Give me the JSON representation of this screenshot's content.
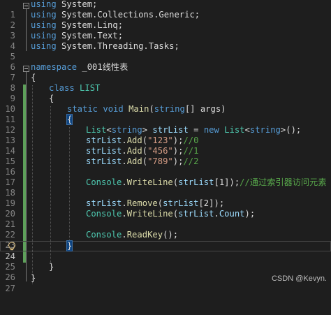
{
  "editor": {
    "current_line": "24",
    "lines": [
      {
        "n": "1"
      },
      {
        "n": "2"
      },
      {
        "n": "3"
      },
      {
        "n": "4"
      },
      {
        "n": "5"
      },
      {
        "n": "6"
      },
      {
        "n": "7"
      },
      {
        "n": "8"
      },
      {
        "n": "9"
      },
      {
        "n": "10"
      },
      {
        "n": "11"
      },
      {
        "n": "12"
      },
      {
        "n": "13"
      },
      {
        "n": "14"
      },
      {
        "n": "15"
      },
      {
        "n": "16"
      },
      {
        "n": "17"
      },
      {
        "n": "18"
      },
      {
        "n": "19"
      },
      {
        "n": "20"
      },
      {
        "n": "21"
      },
      {
        "n": "22"
      },
      {
        "n": "23"
      },
      {
        "n": "24"
      },
      {
        "n": "25"
      },
      {
        "n": "26"
      },
      {
        "n": "27"
      }
    ],
    "tokens": {
      "using": "using",
      "sys": " System;",
      "sys_collections": " System.Collections.Generic;",
      "sys_linq": " System.Linq;",
      "sys_text": " System.Text;",
      "sys_tasks": " System.Threading.Tasks;",
      "namespace_kw": "namespace",
      "namespace_name": " _001线性表",
      "open_brace": "{",
      "close_brace": "}",
      "class_kw": "class",
      "class_name": " LIST",
      "static_kw": "static",
      "void_kw": "void",
      "main": "Main",
      "main_params_open": "(",
      "string_kw": "string",
      "args": "[] args)",
      "list_type": "List",
      "lt": "<",
      "gt_space": "> ",
      "strList": "strList",
      "eq": " = ",
      "new_kw": "new",
      "space": " ",
      "list_ctor_end": ">();",
      "dot_add": ".",
      "add": "Add",
      "paren_open": "(",
      "str_123": "\"123\"",
      "str_456": "\"456\"",
      "str_789": "\"789\"",
      "paren_close_semi": ");",
      "cmt_0": "//0",
      "cmt_1": "//1",
      "cmt_2": "//2",
      "console": "Console",
      "dot": ".",
      "writeline": "WriteLine",
      "idx1": "[1]);",
      "cmt_index": "//通过索引器访问元素",
      "remove": "Remove",
      "idx2": "[2]);",
      "count": "Count",
      "close_paren_semi2": ");",
      "readkey": "ReadKey",
      "readkey_args": "();"
    }
  },
  "watermark": "CSDN @Kevyn."
}
